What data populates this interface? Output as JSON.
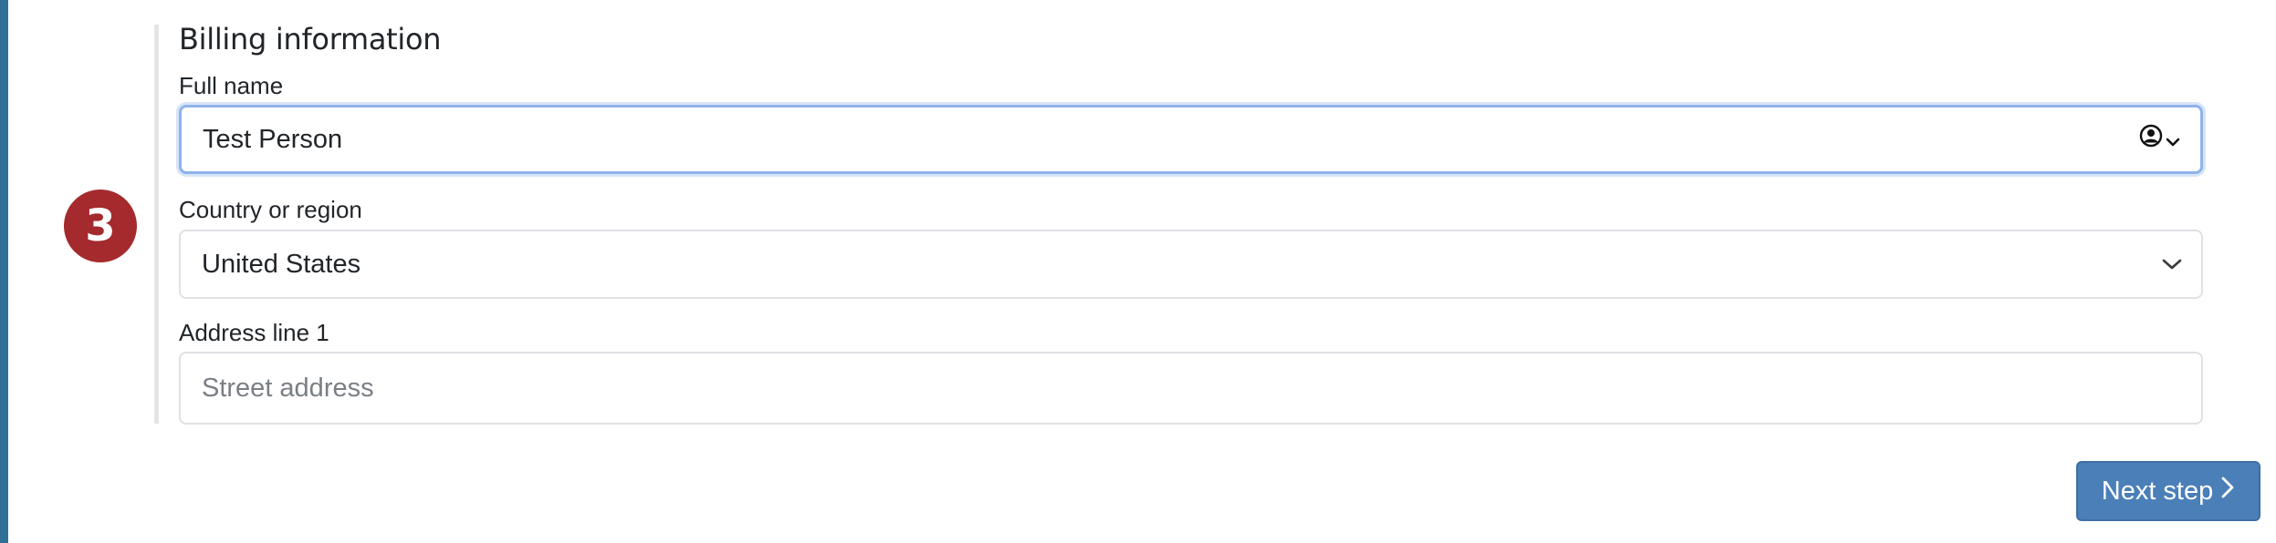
{
  "step": {
    "number": "3"
  },
  "section": {
    "title": "Billing information"
  },
  "fields": {
    "full_name": {
      "label": "Full name",
      "value": "Test Person"
    },
    "country": {
      "label": "Country or region",
      "value": "United States"
    },
    "address1": {
      "label": "Address line 1",
      "placeholder": "Street address"
    }
  },
  "actions": {
    "next_label": "Next step"
  },
  "colors": {
    "accent": "#4a7fb8",
    "badge": "#a42a2e",
    "left_edge": "#2f6f98",
    "focus_ring": "#8fb3ea"
  },
  "icons": {
    "autofill": "person-circle-icon",
    "dropdown": "chevron-down-icon",
    "next": "chevron-right-icon"
  }
}
